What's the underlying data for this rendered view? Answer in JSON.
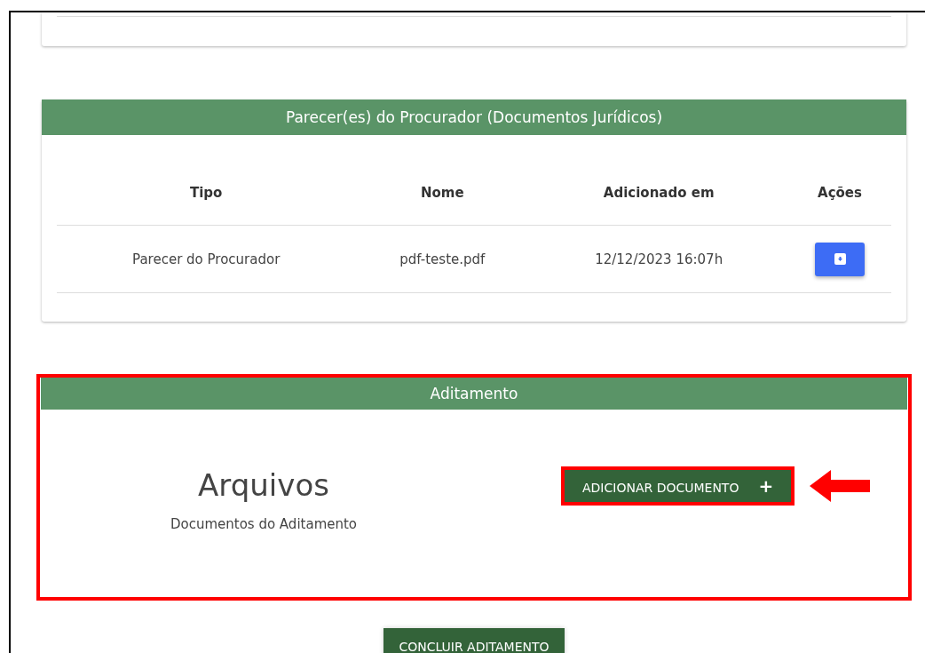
{
  "parecer_section": {
    "title": "Parecer(es) do Procurador (Documentos Jurídicos)",
    "columns": [
      "Tipo",
      "Nome",
      "Adicionado em",
      "Ações"
    ],
    "rows": [
      {
        "tipo": "Parecer do Procurador",
        "nome": "pdf-teste.pdf",
        "adicionado_em": "12/12/2023 16:07h"
      }
    ]
  },
  "aditamento_section": {
    "title": "Aditamento",
    "heading": "Arquivos",
    "subtitle": "Documentos do Aditamento",
    "add_button": {
      "label": "ADICIONAR DOCUMENTO",
      "icon": "+"
    }
  },
  "finish_button": "CONCLUIR ADITAMENTO"
}
